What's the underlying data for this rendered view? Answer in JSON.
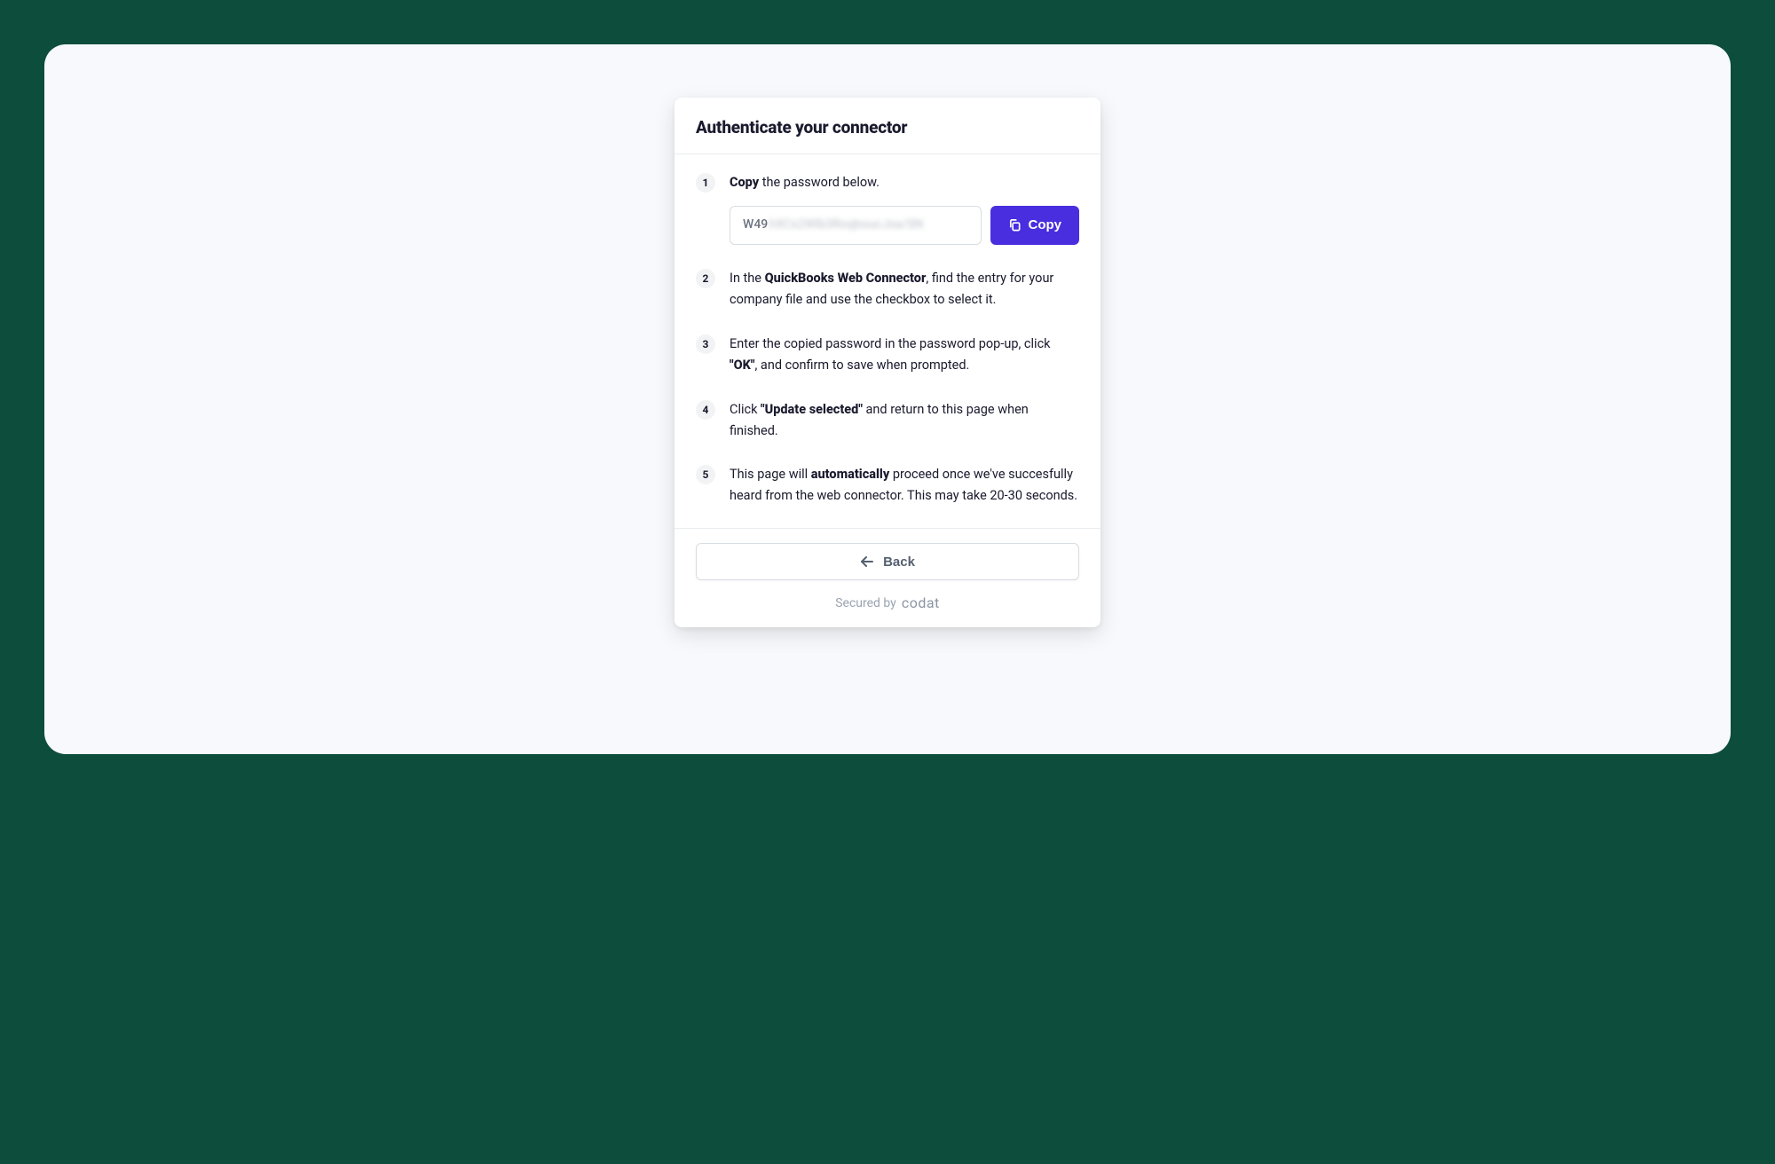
{
  "header": {
    "title": "Authenticate your connector"
  },
  "steps": [
    {
      "number": "1",
      "parts": [
        {
          "text": "Copy",
          "bold": true
        },
        {
          "text": " the password below."
        }
      ]
    },
    {
      "number": "2",
      "parts": [
        {
          "text": "In the "
        },
        {
          "text": "QuickBooks Web Connector",
          "bold": true
        },
        {
          "text": ", find the entry for your company file and use the checkbox to select it."
        }
      ]
    },
    {
      "number": "3",
      "parts": [
        {
          "text": "Enter the copied password in the password pop-up, click "
        },
        {
          "text": "\"OK\"",
          "bold": true
        },
        {
          "text": ", and confirm to save when prompted."
        }
      ]
    },
    {
      "number": "4",
      "parts": [
        {
          "text": "Click "
        },
        {
          "text": "\"Update selected\"",
          "bold": true
        },
        {
          "text": " and return to this page when finished."
        }
      ]
    },
    {
      "number": "5",
      "parts": [
        {
          "text": "This page will "
        },
        {
          "text": "automatically",
          "bold": true
        },
        {
          "text": " proceed once we've succesfully heard from the web connector. This may take 20-30 seconds."
        }
      ]
    }
  ],
  "password": {
    "visible_prefix": "W49",
    "obscured_suffix": "hXCx2Wlb3RoqboucJsa/SN"
  },
  "buttons": {
    "copy_label": "Copy",
    "back_label": "Back"
  },
  "footer": {
    "secured_by_text": "Secured by",
    "brand": "codat"
  }
}
